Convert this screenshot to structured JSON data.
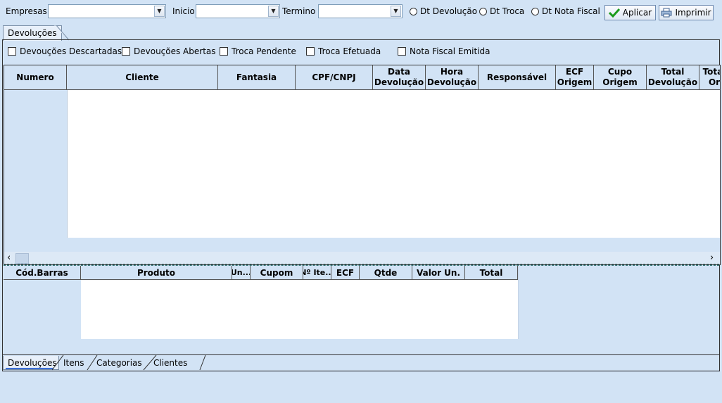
{
  "toolbar": {
    "empresas_label": "Empresas",
    "inicio_label": "Inicio",
    "termino_label": "Termino",
    "radio_devolucao": "Dt Devolução",
    "radio_troca": "Dt Troca",
    "radio_nota": "Dt Nota Fiscal",
    "aplicar": "Aplicar",
    "imprimir": "Imprimir"
  },
  "top_tab": "Devoluções",
  "filters": {
    "descartadas": "Devouções Descartadas",
    "abertas": "Devouções Abertas",
    "troca_pendente": "Troca Pendente",
    "troca_efetuada": "Troca Efetuada",
    "nota_emitida": "Nota Fiscal Emitida"
  },
  "main_grid": {
    "columns": [
      "Numero",
      "Cliente",
      "Fantasia",
      "CPF/CNPJ",
      "Data Devolução",
      "Hora Devolução",
      "Responsável",
      "ECF Origem",
      "Cupo Origem",
      "Total Devolução",
      "Total Or"
    ]
  },
  "items_grid": {
    "columns": [
      "Cód.Barras",
      "Produto",
      "Un...",
      "Cupom",
      "Nº Ite...",
      "ECF",
      "Qtde",
      "Valor Un.",
      "Total"
    ]
  },
  "bottom_tabs": [
    "Devoluções",
    "Itens",
    "Categorias",
    "Clientes"
  ],
  "colors": {
    "background": "#d2e3f5",
    "accent_check": "#1a9a1a"
  }
}
